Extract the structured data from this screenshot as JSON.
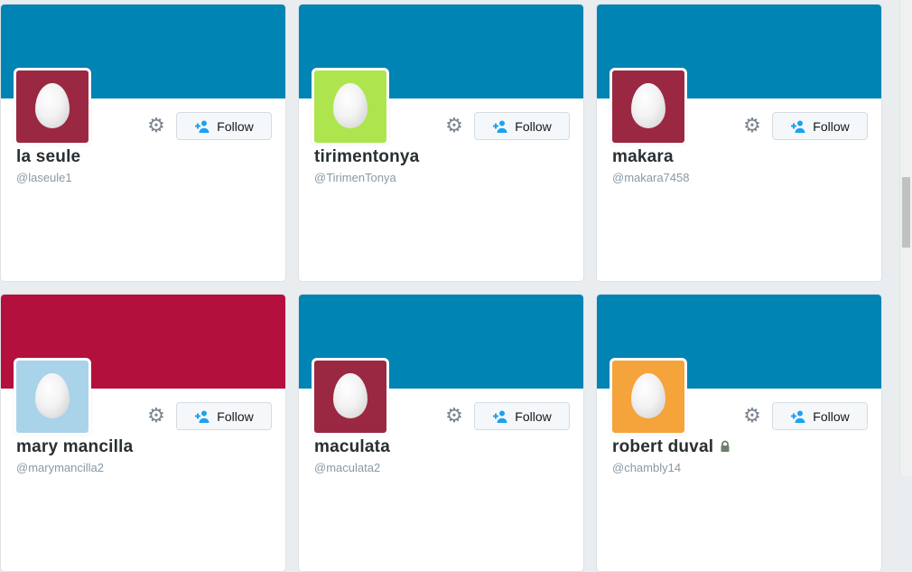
{
  "cards": [
    {
      "name": "la seule",
      "handle": "@laseule1",
      "follow_label": "Follow",
      "banner_color": "#0084b4",
      "avatar_color": "#9b2842",
      "locked": false
    },
    {
      "name": "tirimentonya",
      "handle": "@TirimenTonya",
      "follow_label": "Follow",
      "banner_color": "#0084b4",
      "avatar_color": "#aee54f",
      "locked": false
    },
    {
      "name": "makara",
      "handle": "@makara7458",
      "follow_label": "Follow",
      "banner_color": "#0084b4",
      "avatar_color": "#9b2842",
      "locked": false
    },
    {
      "name": "mary mancilla",
      "handle": "@marymancilla2",
      "follow_label": "Follow",
      "banner_color": "#b4103e",
      "avatar_color": "#a9d3e9",
      "locked": false
    },
    {
      "name": "maculata",
      "handle": "@maculata2",
      "follow_label": "Follow",
      "banner_color": "#0084b4",
      "avatar_color": "#9b2842",
      "locked": false
    },
    {
      "name": "robert duval",
      "handle": "@chambly14",
      "follow_label": "Follow",
      "banner_color": "#0084b4",
      "avatar_color": "#f5a33b",
      "locked": true
    }
  ]
}
